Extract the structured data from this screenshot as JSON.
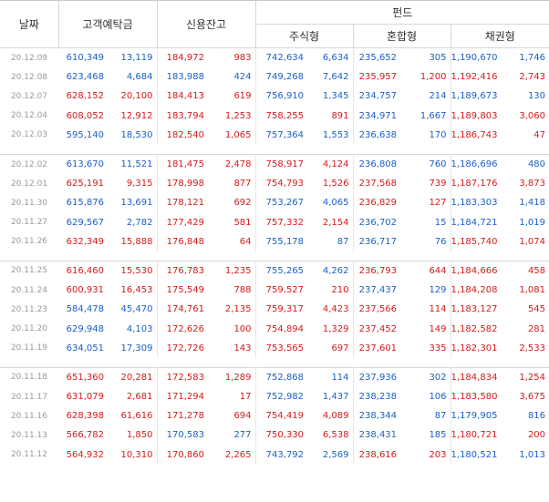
{
  "colors": {
    "up": "#d41a1a",
    "down": "#1a5fc8",
    "date": "#999999"
  },
  "headers": {
    "date": "날짜",
    "deposit": "고객예탁금",
    "credit": "신용잔고",
    "fund": "펀드",
    "stock": "주식형",
    "mixed": "혼합형",
    "bond": "채권형"
  },
  "groups": [
    {
      "rows": [
        {
          "date": "20.12.09",
          "c": [
            [
              "610,349",
              "b"
            ],
            [
              "13,119",
              "b"
            ],
            [
              "184,972",
              "r"
            ],
            [
              "983",
              "r"
            ],
            [
              "742,634",
              "b"
            ],
            [
              "6,634",
              "b"
            ],
            [
              "235,652",
              "b"
            ],
            [
              "305",
              "b"
            ],
            [
              "1,190,670",
              "b"
            ],
            [
              "1,746",
              "b"
            ]
          ]
        },
        {
          "date": "20.12.08",
          "c": [
            [
              "623,468",
              "b"
            ],
            [
              "4,684",
              "b"
            ],
            [
              "183,988",
              "b"
            ],
            [
              "424",
              "b"
            ],
            [
              "749,268",
              "b"
            ],
            [
              "7,642",
              "b"
            ],
            [
              "235,957",
              "r"
            ],
            [
              "1,200",
              "r"
            ],
            [
              "1,192,416",
              "r"
            ],
            [
              "2,743",
              "r"
            ]
          ]
        },
        {
          "date": "20.12.07",
          "c": [
            [
              "628,152",
              "r"
            ],
            [
              "20,100",
              "r"
            ],
            [
              "184,413",
              "r"
            ],
            [
              "619",
              "r"
            ],
            [
              "756,910",
              "b"
            ],
            [
              "1,345",
              "b"
            ],
            [
              "234,757",
              "b"
            ],
            [
              "214",
              "b"
            ],
            [
              "1,189,673",
              "b"
            ],
            [
              "130",
              "b"
            ]
          ]
        },
        {
          "date": "20.12.04",
          "c": [
            [
              "608,052",
              "r"
            ],
            [
              "12,912",
              "r"
            ],
            [
              "183,794",
              "r"
            ],
            [
              "1,253",
              "r"
            ],
            [
              "758,255",
              "r"
            ],
            [
              "891",
              "r"
            ],
            [
              "234,971",
              "b"
            ],
            [
              "1,667",
              "b"
            ],
            [
              "1,189,803",
              "r"
            ],
            [
              "3,060",
              "r"
            ]
          ]
        },
        {
          "date": "20.12.03",
          "c": [
            [
              "595,140",
              "b"
            ],
            [
              "18,530",
              "b"
            ],
            [
              "182,540",
              "r"
            ],
            [
              "1,065",
              "r"
            ],
            [
              "757,364",
              "b"
            ],
            [
              "1,553",
              "b"
            ],
            [
              "236,638",
              "b"
            ],
            [
              "170",
              "b"
            ],
            [
              "1,186,743",
              "r"
            ],
            [
              "47",
              "r"
            ]
          ]
        }
      ]
    },
    {
      "rows": [
        {
          "date": "20.12.02",
          "c": [
            [
              "613,670",
              "b"
            ],
            [
              "11,521",
              "b"
            ],
            [
              "181,475",
              "r"
            ],
            [
              "2,478",
              "r"
            ],
            [
              "758,917",
              "r"
            ],
            [
              "4,124",
              "r"
            ],
            [
              "236,808",
              "b"
            ],
            [
              "760",
              "b"
            ],
            [
              "1,186,696",
              "b"
            ],
            [
              "480",
              "b"
            ]
          ]
        },
        {
          "date": "20.12.01",
          "c": [
            [
              "625,191",
              "r"
            ],
            [
              "9,315",
              "r"
            ],
            [
              "178,998",
              "r"
            ],
            [
              "877",
              "r"
            ],
            [
              "754,793",
              "r"
            ],
            [
              "1,526",
              "r"
            ],
            [
              "237,568",
              "r"
            ],
            [
              "739",
              "r"
            ],
            [
              "1,187,176",
              "r"
            ],
            [
              "3,873",
              "r"
            ]
          ]
        },
        {
          "date": "20.11.30",
          "c": [
            [
              "615,876",
              "b"
            ],
            [
              "13,691",
              "b"
            ],
            [
              "178,121",
              "r"
            ],
            [
              "692",
              "r"
            ],
            [
              "753,267",
              "b"
            ],
            [
              "4,065",
              "b"
            ],
            [
              "236,829",
              "r"
            ],
            [
              "127",
              "r"
            ],
            [
              "1,183,303",
              "b"
            ],
            [
              "1,418",
              "b"
            ]
          ]
        },
        {
          "date": "20.11.27",
          "c": [
            [
              "629,567",
              "b"
            ],
            [
              "2,782",
              "b"
            ],
            [
              "177,429",
              "r"
            ],
            [
              "581",
              "r"
            ],
            [
              "757,332",
              "r"
            ],
            [
              "2,154",
              "r"
            ],
            [
              "236,702",
              "b"
            ],
            [
              "15",
              "b"
            ],
            [
              "1,184,721",
              "b"
            ],
            [
              "1,019",
              "b"
            ]
          ]
        },
        {
          "date": "20.11.26",
          "c": [
            [
              "632,349",
              "r"
            ],
            [
              "15,888",
              "r"
            ],
            [
              "176,848",
              "r"
            ],
            [
              "64",
              "r"
            ],
            [
              "755,178",
              "b"
            ],
            [
              "87",
              "b"
            ],
            [
              "236,717",
              "b"
            ],
            [
              "76",
              "b"
            ],
            [
              "1,185,740",
              "r"
            ],
            [
              "1,074",
              "r"
            ]
          ]
        }
      ]
    },
    {
      "rows": [
        {
          "date": "20.11.25",
          "c": [
            [
              "616,460",
              "r"
            ],
            [
              "15,530",
              "r"
            ],
            [
              "176,783",
              "r"
            ],
            [
              "1,235",
              "r"
            ],
            [
              "755,265",
              "b"
            ],
            [
              "4,262",
              "b"
            ],
            [
              "236,793",
              "r"
            ],
            [
              "644",
              "r"
            ],
            [
              "1,184,666",
              "r"
            ],
            [
              "458",
              "r"
            ]
          ]
        },
        {
          "date": "20.11.24",
          "c": [
            [
              "600,931",
              "r"
            ],
            [
              "16,453",
              "r"
            ],
            [
              "175,549",
              "r"
            ],
            [
              "788",
              "r"
            ],
            [
              "759,527",
              "r"
            ],
            [
              "210",
              "r"
            ],
            [
              "237,437",
              "b"
            ],
            [
              "129",
              "b"
            ],
            [
              "1,184,208",
              "r"
            ],
            [
              "1,081",
              "r"
            ]
          ]
        },
        {
          "date": "20.11.23",
          "c": [
            [
              "584,478",
              "b"
            ],
            [
              "45,470",
              "b"
            ],
            [
              "174,761",
              "r"
            ],
            [
              "2,135",
              "r"
            ],
            [
              "759,317",
              "r"
            ],
            [
              "4,423",
              "r"
            ],
            [
              "237,566",
              "r"
            ],
            [
              "114",
              "r"
            ],
            [
              "1,183,127",
              "r"
            ],
            [
              "545",
              "r"
            ]
          ]
        },
        {
          "date": "20.11.20",
          "c": [
            [
              "629,948",
              "b"
            ],
            [
              "4,103",
              "b"
            ],
            [
              "172,626",
              "r"
            ],
            [
              "100",
              "r"
            ],
            [
              "754,894",
              "r"
            ],
            [
              "1,329",
              "r"
            ],
            [
              "237,452",
              "r"
            ],
            [
              "149",
              "r"
            ],
            [
              "1,182,582",
              "r"
            ],
            [
              "281",
              "r"
            ]
          ]
        },
        {
          "date": "20.11.19",
          "c": [
            [
              "634,051",
              "b"
            ],
            [
              "17,309",
              "b"
            ],
            [
              "172,726",
              "r"
            ],
            [
              "143",
              "r"
            ],
            [
              "753,565",
              "r"
            ],
            [
              "697",
              "r"
            ],
            [
              "237,601",
              "r"
            ],
            [
              "335",
              "r"
            ],
            [
              "1,182,301",
              "r"
            ],
            [
              "2,533",
              "r"
            ]
          ]
        }
      ]
    },
    {
      "rows": [
        {
          "date": "20.11.18",
          "c": [
            [
              "651,360",
              "r"
            ],
            [
              "20,281",
              "r"
            ],
            [
              "172,583",
              "r"
            ],
            [
              "1,289",
              "r"
            ],
            [
              "752,868",
              "b"
            ],
            [
              "114",
              "b"
            ],
            [
              "237,936",
              "b"
            ],
            [
              "302",
              "b"
            ],
            [
              "1,184,834",
              "r"
            ],
            [
              "1,254",
              "r"
            ]
          ]
        },
        {
          "date": "20.11.17",
          "c": [
            [
              "631,079",
              "r"
            ],
            [
              "2,681",
              "r"
            ],
            [
              "171,294",
              "r"
            ],
            [
              "17",
              "r"
            ],
            [
              "752,982",
              "b"
            ],
            [
              "1,437",
              "b"
            ],
            [
              "238,238",
              "b"
            ],
            [
              "106",
              "b"
            ],
            [
              "1,183,580",
              "r"
            ],
            [
              "3,675",
              "r"
            ]
          ]
        },
        {
          "date": "20.11.16",
          "c": [
            [
              "628,398",
              "r"
            ],
            [
              "61,616",
              "r"
            ],
            [
              "171,278",
              "r"
            ],
            [
              "694",
              "r"
            ],
            [
              "754,419",
              "r"
            ],
            [
              "4,089",
              "r"
            ],
            [
              "238,344",
              "b"
            ],
            [
              "87",
              "b"
            ],
            [
              "1,179,905",
              "b"
            ],
            [
              "816",
              "b"
            ]
          ]
        },
        {
          "date": "20.11.13",
          "c": [
            [
              "566,782",
              "r"
            ],
            [
              "1,850",
              "r"
            ],
            [
              "170,583",
              "b"
            ],
            [
              "277",
              "b"
            ],
            [
              "750,330",
              "r"
            ],
            [
              "6,538",
              "r"
            ],
            [
              "238,431",
              "b"
            ],
            [
              "185",
              "b"
            ],
            [
              "1,180,721",
              "r"
            ],
            [
              "200",
              "r"
            ]
          ]
        },
        {
          "date": "20.11.12",
          "c": [
            [
              "564,932",
              "r"
            ],
            [
              "10,310",
              "r"
            ],
            [
              "170,860",
              "r"
            ],
            [
              "2,265",
              "r"
            ],
            [
              "743,792",
              "b"
            ],
            [
              "2,569",
              "b"
            ],
            [
              "238,616",
              "r"
            ],
            [
              "203",
              "r"
            ],
            [
              "1,180,521",
              "b"
            ],
            [
              "1,013",
              "b"
            ]
          ]
        }
      ]
    }
  ]
}
